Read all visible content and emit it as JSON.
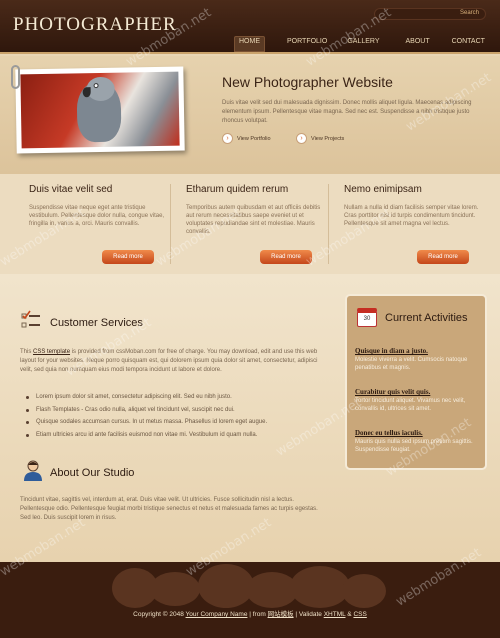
{
  "header": {
    "logo": "PHOTOGRAPHER",
    "search_button": "Search",
    "nav": [
      "HOME",
      "PORTFOLIO",
      "GALLERY",
      "ABOUT",
      "CONTACT"
    ]
  },
  "hero": {
    "title": "New Photographer Website",
    "text": "Duis vitae velit sed dui malesuada dignissim. Donec mollis aliquet ligula. Maecenas adipiscing elementum ipsum. Pellentesque vitae magna. Sed nec est. Suspendisse a nibh tristique justo rhoncus volutpat.",
    "btn_portfolio": "View Portfolio",
    "btn_projects": "View Projects"
  },
  "columns": [
    {
      "title": "Duis vitae velit sed",
      "text": "Suspendisse vitae neque eget ante tristique vestibulum. Pellentesque dolor nulla, congue vitae, fringilla in, varius a, orci. Mauris convallis.",
      "button": "Read more"
    },
    {
      "title": "Etharum quidem rerum",
      "text": "Temporibus autem quibusdam et aut officiis debitis aut rerum necessitatibus saepe eveniet ut et voluptates repudiandae sint et molestiae. Mauris convallis.",
      "button": "Read more"
    },
    {
      "title": "Nemo enimipsam",
      "text": "Nullam a nulla id diam facilisis semper vitae lorem. Cras porttitor nisi id turpis condimentum tincidunt. Pellentesque sit amet magna vel lectus.",
      "button": "Read more"
    }
  ],
  "customer_services": {
    "title": "Customer Services",
    "text_pre": "This ",
    "text_link": "CSS template",
    "text_post": " is provided from cssMoban.com for free of charge. You may download, edit and use this web layout for your websites. Neque porro quisquam est, qui dolorem ipsum quia dolor sit amet, consectetur, adipisci velit, sed quia non numquam eius modi tempora incidunt ut labore et dolore.",
    "bullets": [
      "Lorem ipsum dolor sit amet, consectetur adipiscing elit. Sed eu nibh justo.",
      "Flash Templates - Cras odio nulla, aliquet vel tincidunt vel, suscipit nec dui.",
      "Quisque sodales accumsan cursus. In ut metus massa. Phasellus id lorem eget augue.",
      "Etiam ultricies arcu id ante facilisis euismod non vitae mi. Vestibulum id quam nulla."
    ]
  },
  "studio": {
    "title": "About Our Studio",
    "text": "Tincidunt vitae, sagittis vel, interdum at, erat. Duis vitae velit. Ut ultricies. Fusce sollicitudin nisl a lectus. Pellentesque odio. Pellentesque feugiat morbi tristique senectus et netus et malesuada fames ac turpis egestas. Sed leo. Duis suscipit lorem in risus."
  },
  "sidebar": {
    "title": "Current Activities",
    "calendar_day": "30",
    "items": [
      {
        "title": "Quisque in diam a justo.",
        "text": "Molestie viverra a velit. Cumsocis natoque penatibus et magnis."
      },
      {
        "title": "Curabitur quis velit quis.",
        "text": "Tortor tincidunt aliquet. Vivamus nec velit, convallis id, ultrices sit amet."
      },
      {
        "title": "Donec eu tellus iaculis.",
        "text": "Mauris quis nulla sed ipsum pretium sagittis. Suspendisse feugiat."
      }
    ]
  },
  "footer": {
    "copyright_pre": "Copyright © 2048 ",
    "company": "Your Company Name",
    "from_pre": " | from ",
    "from_link": "网站模板",
    "validate_pre": " | Validate ",
    "html": "XHTML",
    "amp": " & ",
    "css": "CSS"
  },
  "watermark": "webmoban.net"
}
